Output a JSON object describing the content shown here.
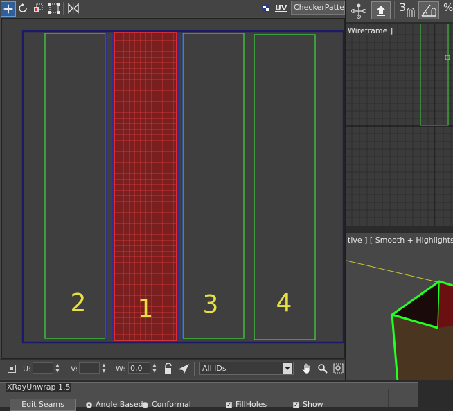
{
  "toolbar": {
    "icons": [
      "move-icon",
      "rotate-icon",
      "scale-icon",
      "freeform-icon",
      "mirror-icon"
    ],
    "uv_label": "UV",
    "map_dropdown": "CheckerPattern"
  },
  "uv_canvas": {
    "island_labels": [
      "2",
      "1",
      "3",
      "4"
    ],
    "colors": {
      "uv_border": "#1a1a66",
      "island": "#3cdc3c",
      "selected": "#dc2828",
      "label": "#e8e040"
    }
  },
  "status_bar": {
    "u_label": "U:",
    "u_value": "",
    "v_label": "V:",
    "v_value": "",
    "w_label": "W:",
    "w_value": "0,0",
    "id_filter": "All IDs"
  },
  "right_toolbar": {
    "number": "3",
    "percent": "%"
  },
  "viewports": {
    "top_label": "Wireframe ]",
    "persp_label": "tive ] [ Smooth + Highlights ]"
  },
  "rollout": {
    "title": "XRayUnwrap 1.5",
    "edit_seams_button": "Edit Seams",
    "angle_based_label": "Angle Based",
    "conformal_label": "Conformal",
    "fill_holes_label": "FillHoles",
    "show_label": "Show"
  }
}
